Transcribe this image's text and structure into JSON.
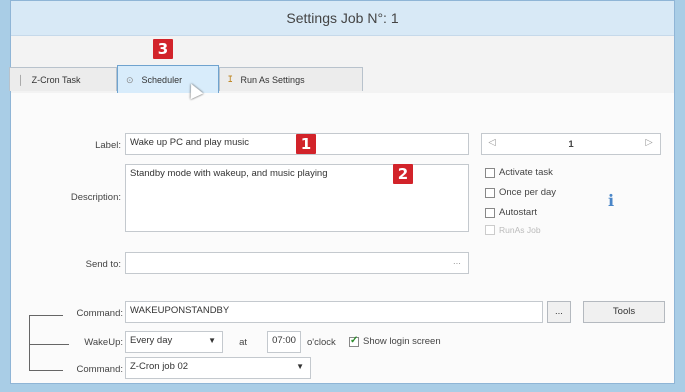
{
  "window": {
    "title": "Settings Job N°: 1"
  },
  "badges": {
    "b1": "1",
    "b2": "2",
    "b3": "3"
  },
  "tabs": [
    {
      "label": "Z-Cron Task"
    },
    {
      "label": "Scheduler"
    },
    {
      "label": "Run As Settings"
    }
  ],
  "form": {
    "label_caption": "Label:",
    "label_value": "Wake up PC and play music",
    "description_caption": "Description:",
    "description_value": "Standby mode with wakeup, and music playing",
    "sendto_caption": "Send to:",
    "sendto_value": "",
    "browse_label": "...",
    "nav": {
      "prev": "◁",
      "next": "▷",
      "number": "1"
    },
    "checkboxes": [
      {
        "label": "Activate task",
        "checked": false,
        "disabled": false
      },
      {
        "label": "Once per day",
        "checked": false,
        "disabled": false
      },
      {
        "label": "Autostart",
        "checked": false,
        "disabled": false
      },
      {
        "label": "RunAs Job",
        "checked": false,
        "disabled": true
      }
    ],
    "command_caption": "Command:",
    "command_value": "WAKEUPONSTANDBY",
    "command_browse": "...",
    "tools_label": "Tools",
    "wakeup_caption": "WakeUp:",
    "wakeup_value": "Every day",
    "at_label": "at",
    "time_value": "07:00",
    "oclock_label": "o'clock",
    "show_login_label": "Show login screen",
    "show_login_checked": true,
    "command2_caption": "Command:",
    "command2_value": "Z-Cron job 02"
  },
  "colors": {
    "badge": "#d2232a",
    "active_tab": "#d8ecfb",
    "background": "#a9cde6"
  }
}
